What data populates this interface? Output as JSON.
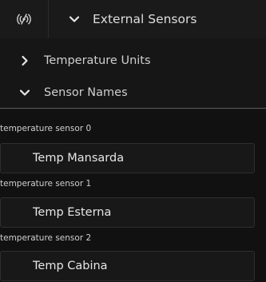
{
  "header": {
    "icon": "sensor-waves-icon",
    "toggle_icon": "chevron-down-icon",
    "title": "External Sensors"
  },
  "sections": [
    {
      "label": "Temperature Units",
      "state": "collapsed",
      "icon": "chevron-right-icon"
    },
    {
      "label": "Sensor Names",
      "state": "expanded",
      "icon": "chevron-down-icon"
    }
  ],
  "sensors": [
    {
      "label": "temperature sensor 0",
      "value": "Temp Mansarda"
    },
    {
      "label": "temperature sensor 1",
      "value": "Temp Esterna"
    },
    {
      "label": "temperature sensor 2",
      "value": "Temp Cabina"
    }
  ],
  "colors": {
    "background": "#111111",
    "header_bg": "#1a1a1a",
    "text": "#dedede",
    "field_border": "#2e2e2e"
  }
}
